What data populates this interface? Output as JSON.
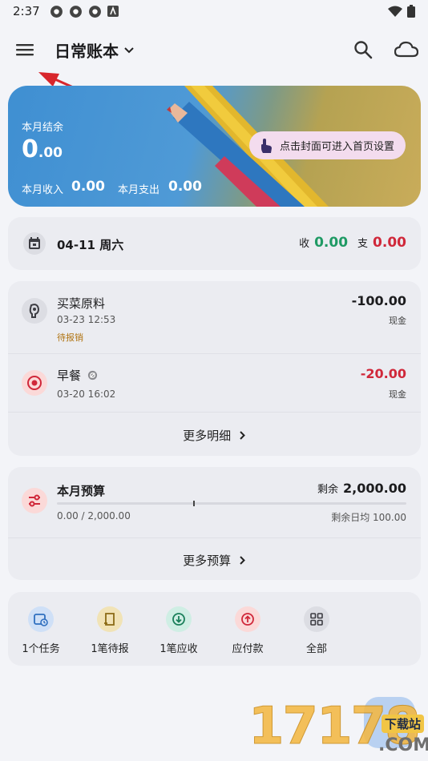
{
  "status_bar": {
    "time": "2:37"
  },
  "header": {
    "book_title": "日常账本"
  },
  "cover": {
    "balance_label": "本月结余",
    "balance_int": "0",
    "balance_dec": ".00",
    "income_label": "本月收入",
    "income_value": "0.00",
    "expense_label": "本月支出",
    "expense_value": "0.00",
    "hint": "点击封面可进入首页设置"
  },
  "today": {
    "date": "04-11 周六",
    "income_label": "收",
    "income_value": "0.00",
    "expense_label": "支",
    "expense_value": "0.00"
  },
  "transactions": [
    {
      "name": "买菜原料",
      "time": "03-23 12:53",
      "tag": "待报销",
      "amount": "-100.00",
      "account": "现金"
    },
    {
      "name": "早餐",
      "time": "03-20 16:02",
      "tag": "",
      "amount": "-20.00",
      "account": "现金"
    }
  ],
  "more_details": "更多明细",
  "budget": {
    "title": "本月预算",
    "remain_label": "剩余",
    "remain_value": "2,000.00",
    "usage": "0.00 / 2,000.00",
    "daily_avg": "剩余日均 100.00",
    "more": "更多预算"
  },
  "quick_actions": [
    {
      "label": "1个任务"
    },
    {
      "label": "1笔待报"
    },
    {
      "label": "1笔应收"
    },
    {
      "label": "应付款"
    },
    {
      "label": "全部"
    }
  ],
  "watermark": {
    "number": "17178",
    "site": "下载站",
    "domain": ".COM"
  },
  "colors": {
    "income": "#1f9a64",
    "expense": "#d0283a",
    "pending": "#b07412"
  }
}
